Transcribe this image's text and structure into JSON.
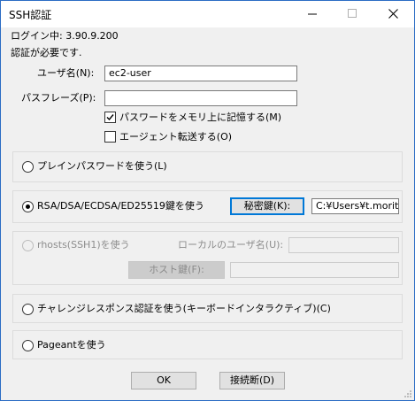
{
  "window": {
    "title": "SSH認証"
  },
  "header": {
    "login_status": "ログイン中: 3.90.9.200",
    "auth_required": "認証が必要です."
  },
  "form": {
    "username_label": "ユーザ名(N):",
    "username_value": "ec2-user",
    "passphrase_label": "パスフレーズ(P):",
    "passphrase_value": "",
    "remember_password_label": "パスワードをメモリ上に記憶する(M)",
    "remember_password_checked": true,
    "agent_forwarding_label": "エージェント転送する(O)",
    "agent_forwarding_checked": false
  },
  "methods": {
    "plain_password_label": "プレインパスワードを使う(L)",
    "rsa_label": "RSA/DSA/ECDSA/ED25519鍵を使う",
    "private_key_button": "秘密鍵(K):",
    "private_key_path": "C:¥Users¥t.morita¥",
    "rhosts_label": "rhosts(SSH1)を使う",
    "local_username_label": "ローカルのユーザ名(U):",
    "local_username_value": "",
    "host_key_button": "ホスト鍵(F):",
    "host_key_value": "",
    "challenge_label": "チャレンジレスポンス認証を使う(キーボードインタラクティブ)(C)",
    "pageant_label": "Pageantを使う",
    "selected": "rsa"
  },
  "footer": {
    "ok_button": "OK",
    "disconnect_button": "接続断(D)"
  }
}
